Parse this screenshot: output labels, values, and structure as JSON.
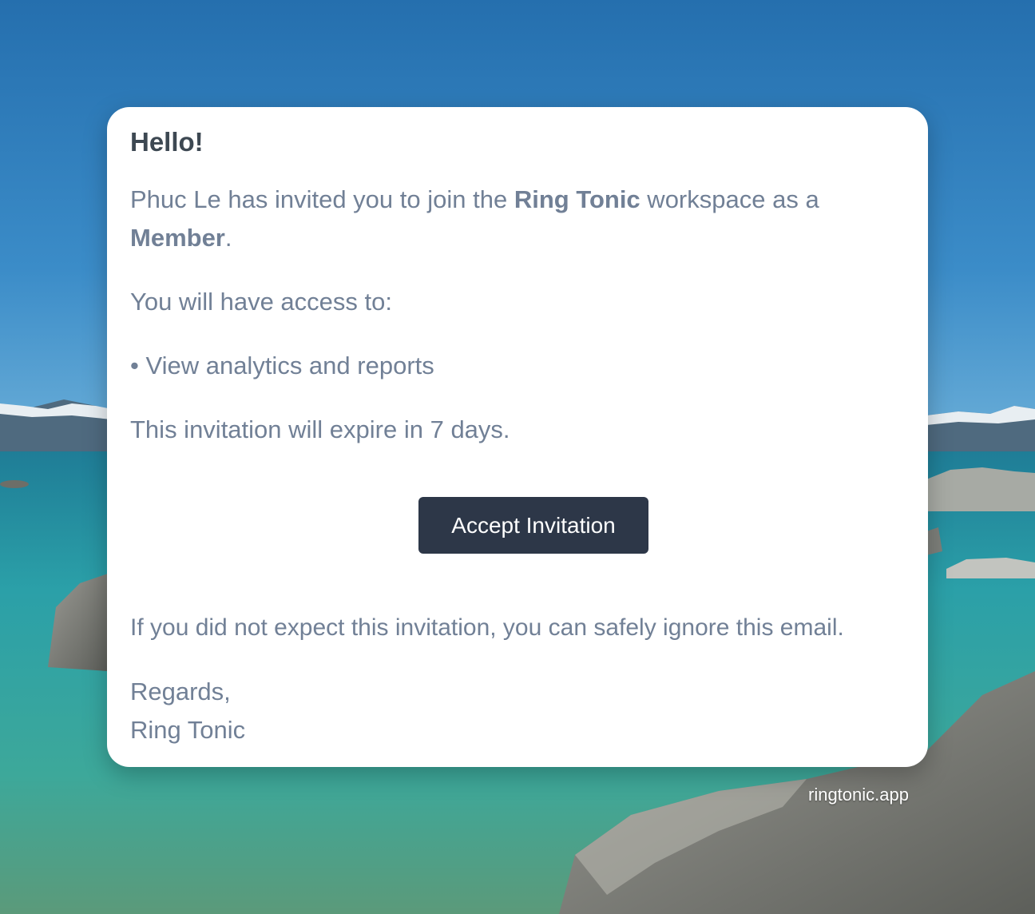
{
  "email": {
    "greeting": "Hello!",
    "invite_line": {
      "prefix": "Phuc Le has invited you to join the ",
      "workspace": "Ring Tonic",
      "middle": " workspace as a ",
      "role": "Member",
      "suffix": "."
    },
    "access_intro": "You will have access to:",
    "access_items": [
      "• View analytics and reports"
    ],
    "expiry_notice": "This invitation will expire in 7 days.",
    "accept_button_label": "Accept Invitation",
    "ignore_notice": "If you did not expect this invitation, you can safely ignore this email.",
    "signoff": "Regards,",
    "signature": "Ring Tonic"
  },
  "footer": {
    "link_text": "ringtonic.app"
  },
  "colors": {
    "button_bg": "#2d3748",
    "body_text": "#718096",
    "heading_text": "#3d4852",
    "card_bg": "#ffffff"
  }
}
